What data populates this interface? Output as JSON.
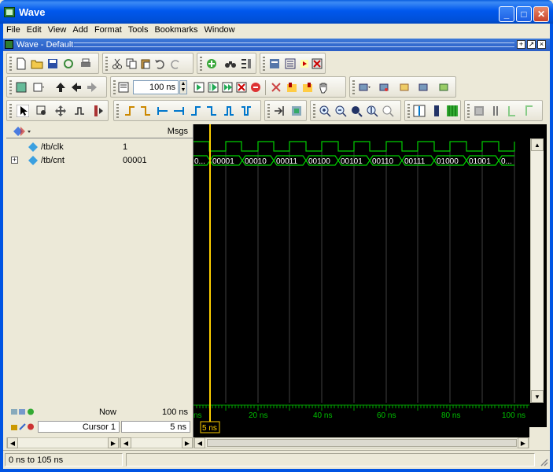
{
  "window": {
    "title": "Wave",
    "controls": {
      "minimize": "_",
      "maximize": "□",
      "close": "✕"
    }
  },
  "menu": [
    "File",
    "Edit",
    "View",
    "Add",
    "Format",
    "Tools",
    "Bookmarks",
    "Window"
  ],
  "subwindow": {
    "title": "Wave - Default"
  },
  "toolbar": {
    "time_step_value": "100 ns"
  },
  "signals": {
    "header_msgs": "Msgs",
    "rows": [
      {
        "name": "/tb/clk",
        "value": "1",
        "expandable": false
      },
      {
        "name": "/tb/cnt",
        "value": "00001",
        "expandable": true
      }
    ]
  },
  "bus_labels": [
    "0...",
    "00001",
    "00010",
    "00011",
    "00100",
    "00101",
    "00110",
    "00111",
    "01000",
    "01001",
    "0..."
  ],
  "cursor_panel": {
    "now_label": "Now",
    "now_value": "100 ns",
    "cursor_label": "Cursor 1",
    "cursor_value": "5 ns",
    "cursor_tag": "5 ns"
  },
  "timeline": {
    "ticks": [
      "ns",
      "20 ns",
      "40 ns",
      "60 ns",
      "80 ns",
      "100 ns"
    ]
  },
  "status": {
    "range": "0 ns to 105 ns"
  },
  "colors": {
    "wave_green": "#00d000",
    "cursor_yellow": "#ffd000",
    "grid": "#404040"
  }
}
